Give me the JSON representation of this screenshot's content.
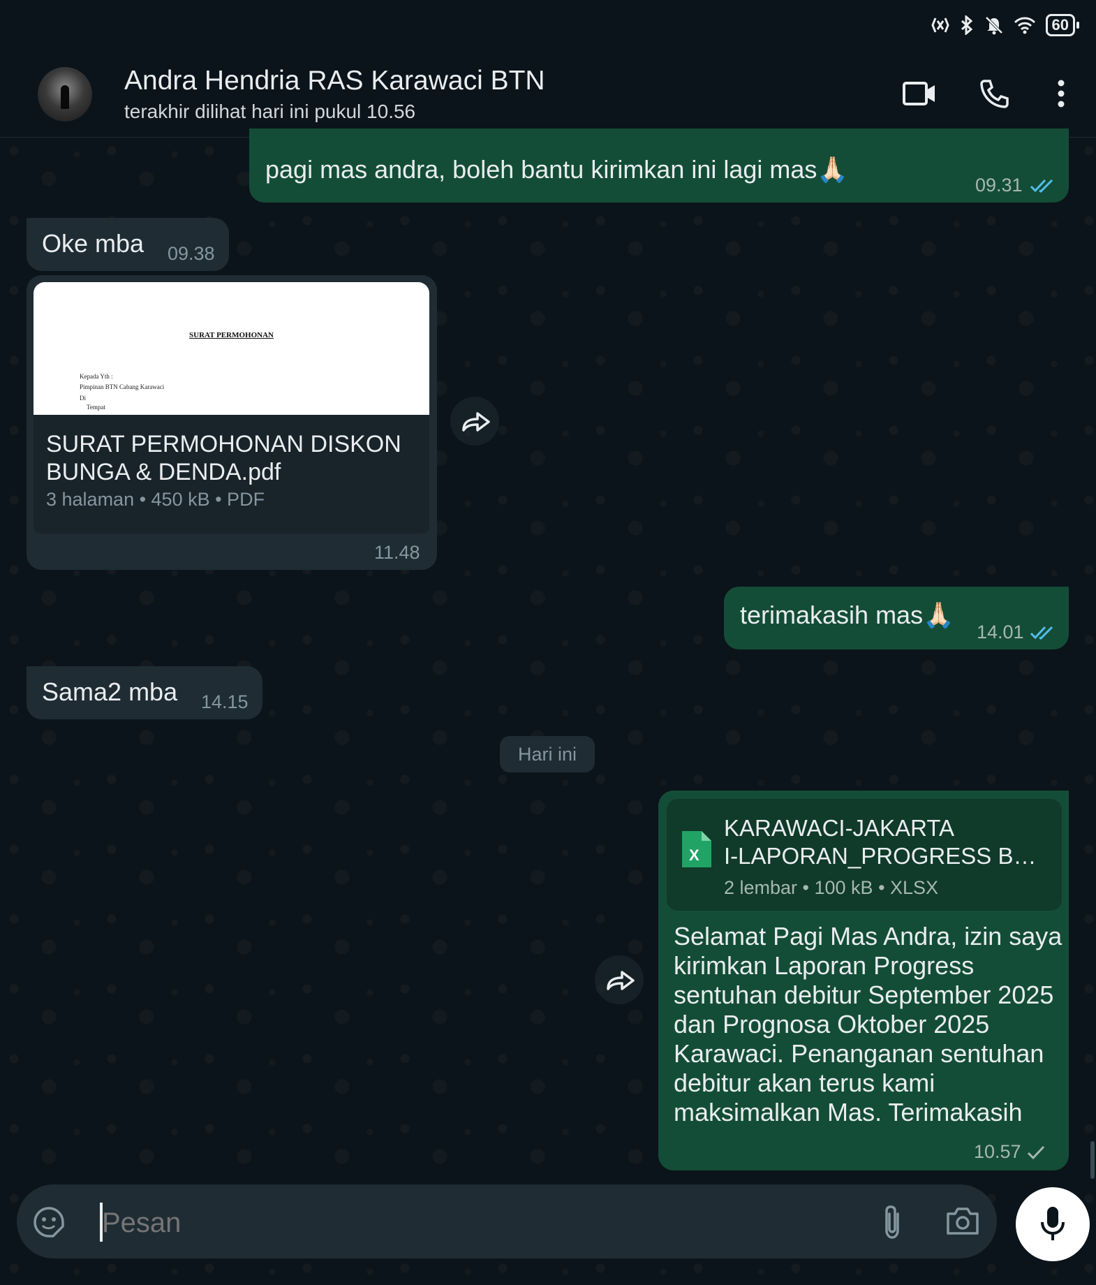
{
  "status_bar": {
    "battery": "60"
  },
  "header": {
    "contact_name": "Andra Hendria RAS Karawaci BTN",
    "last_seen": "terakhir dilihat hari ini pukul 10.56"
  },
  "messages": [
    {
      "direction": "out",
      "text": "pagi mas andra, boleh bantu kirimkan ini lagi mas🙏🏻",
      "time": "09.31",
      "status": "read"
    },
    {
      "direction": "in",
      "text": "Oke mba",
      "time": "09.38"
    },
    {
      "direction": "in",
      "type": "document",
      "preview": {
        "title": "SURAT PERMOHONAN",
        "lines": [
          "Kepada Yth :",
          "Pimpinan BTN Cabang Karawaci",
          "Di",
          "Tempat"
        ]
      },
      "file_name_line1": "SURAT PERMOHONAN DISKON",
      "file_name_line2": "BUNGA & DENDA.pdf",
      "meta": "3 halaman  •  450 kB  •  PDF",
      "time": "11.48"
    },
    {
      "direction": "out",
      "text": "terimakasih mas🙏🏻",
      "time": "14.01",
      "status": "read"
    },
    {
      "direction": "in",
      "text": "Sama2 mba",
      "time": "14.15"
    },
    {
      "direction": "out",
      "type": "document",
      "file_name_line1": "KARAWACI-JAKARTA",
      "file_name_line2": "I-LAPORAN_PROGRESS B…",
      "meta": "2 lembar  •  100 kB  •  XLSX",
      "file_icon_label": "X",
      "caption": "Selamat Pagi Mas Andra, izin saya kirimkan Laporan Progress sentuhan debitur September 2025 dan Prognosa Oktober 2025 Karawaci. Penanganan sentuhan debitur akan terus kami maksimalkan Mas. Terimakasih",
      "time": "10.57",
      "status": "sent"
    }
  ],
  "date_separator": "Hari ini",
  "input": {
    "placeholder": "Pesan"
  },
  "colors": {
    "outgoing_bubble": "#144d37",
    "incoming_bubble": "#1f2c34",
    "read_tick": "#53bdeb",
    "background": "#0b141a"
  }
}
